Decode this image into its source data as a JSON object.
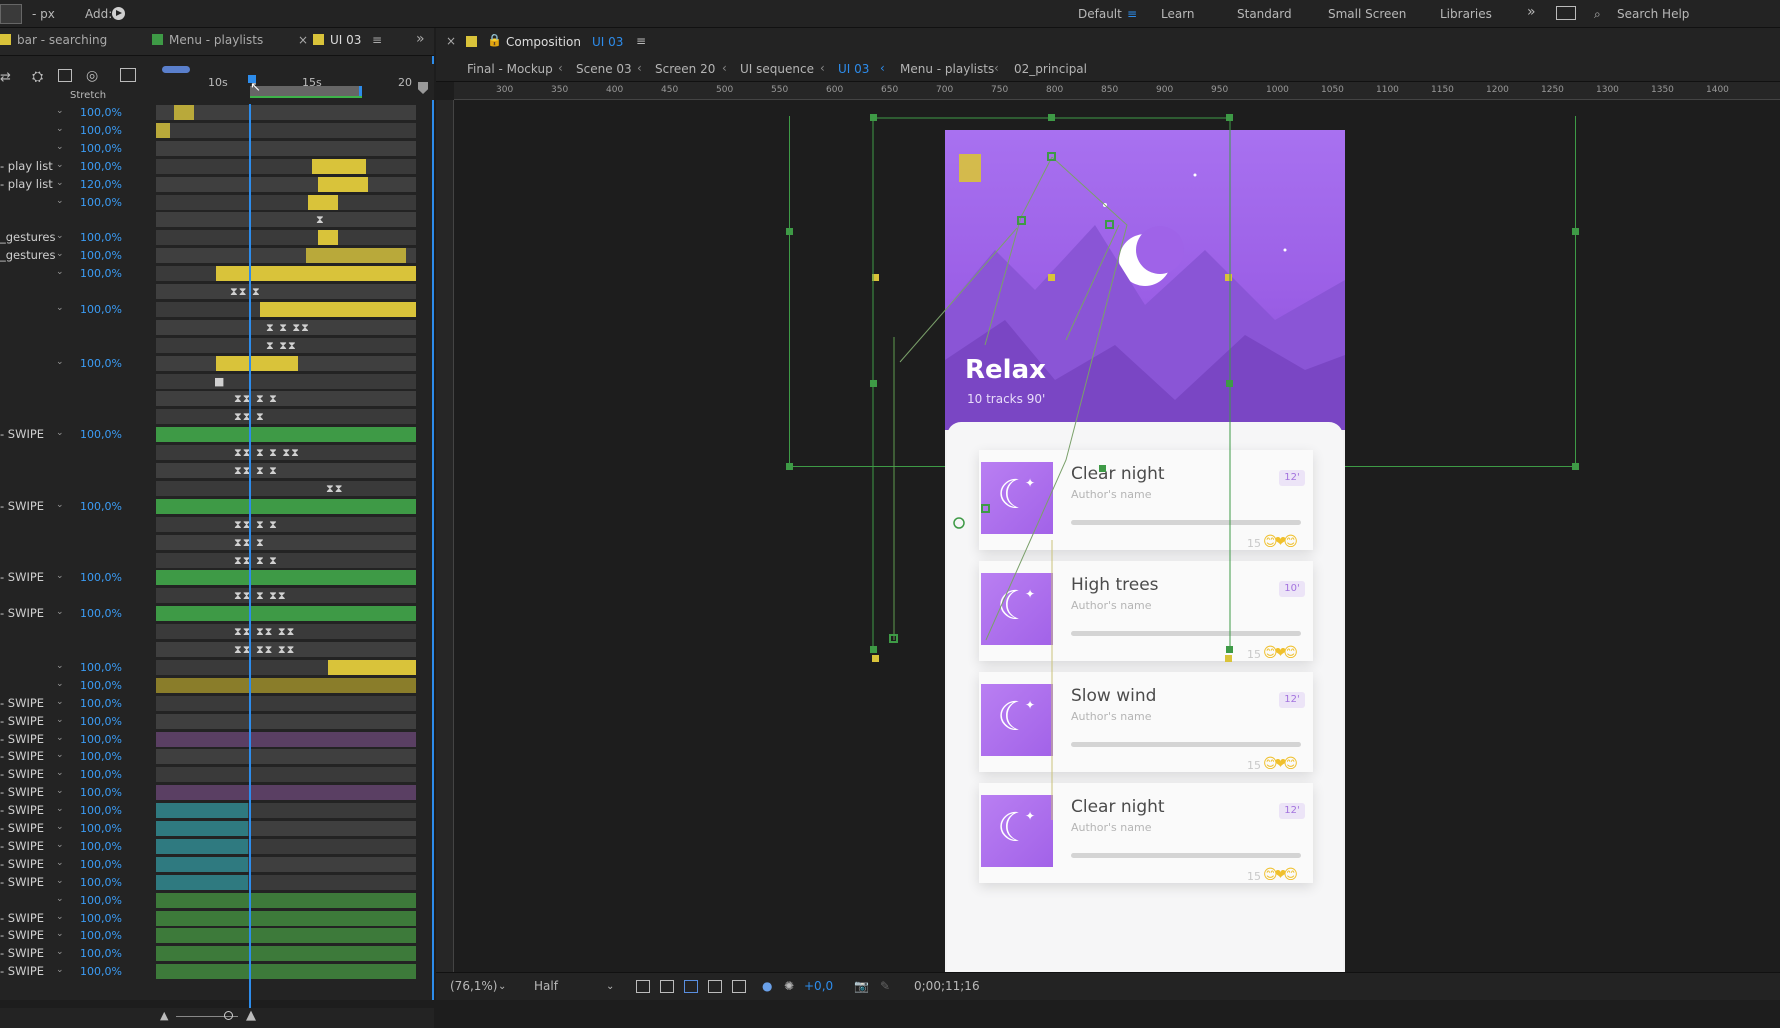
{
  "topbar": {
    "units": "- px",
    "add_label": "Add:",
    "workspaces": [
      "Default",
      "Learn",
      "Standard",
      "Small Screen",
      "Libraries"
    ],
    "active_workspace": "Default",
    "search_label": "Search Help"
  },
  "left_tabs": [
    {
      "label": "bar - searching",
      "color": "#d9c33a"
    },
    {
      "label": "Menu - playlists",
      "color": "#3e9a46"
    },
    {
      "label": "UI 03",
      "color": "#d9c33a"
    }
  ],
  "timeline": {
    "ruler_labels": [
      "10s",
      "15s",
      "20"
    ],
    "column_header": "Stretch",
    "rows": [
      {
        "name": "",
        "value": "100,0%",
        "bar": {
          "color": "#b9a93a"
        },
        "kf": ""
      },
      {
        "name": "",
        "value": "100,0%",
        "bar": {
          "color": "#b9a93a"
        },
        "kf": ""
      },
      {
        "name": "",
        "value": "100,0%",
        "bar": null,
        "kf": ""
      },
      {
        "name": "- play list",
        "value": "100,0%",
        "bar": {
          "color": "#d9c33a"
        },
        "kf": ""
      },
      {
        "name": "- play list",
        "value": "120,0%",
        "bar": {
          "color": "#d9c33a"
        },
        "kf": ""
      },
      {
        "name": "",
        "value": "100,0%",
        "bar": {
          "color": "#d9c33a"
        },
        "kf": ""
      },
      {
        "name": "",
        "value": "",
        "bar": null,
        "kf": "⧗"
      },
      {
        "name": "_gestures",
        "value": "100,0%",
        "bar": {
          "color": "#d9c33a"
        },
        "kf": ""
      },
      {
        "name": "_gestures",
        "value": "100,0%",
        "bar": {
          "color": "#b9a93a"
        },
        "kf": ""
      },
      {
        "name": "",
        "value": "100,0%",
        "bar": {
          "color": "#d9c33a"
        },
        "kf": ""
      },
      {
        "name": "",
        "value": "",
        "bar": null,
        "kf": "⧗⧗ ⧗"
      },
      {
        "name": "",
        "value": "100,0%",
        "bar": {
          "color": "#d9c33a"
        },
        "kf": ""
      },
      {
        "name": "",
        "value": "",
        "bar": null,
        "kf": "⧗ ⧗  ⧗⧗"
      },
      {
        "name": "",
        "value": "",
        "bar": null,
        "kf": "⧗    ⧗⧗"
      },
      {
        "name": "",
        "value": "100,0%",
        "bar": {
          "color": "#d9c33a"
        },
        "kf": ""
      },
      {
        "name": "",
        "value": "",
        "bar": null,
        "kf": "■"
      },
      {
        "name": "",
        "value": "",
        "bar": null,
        "kf": "⧗⧗ ⧗ ⧗"
      },
      {
        "name": "",
        "value": "",
        "bar": null,
        "kf": "⧗⧗ ⧗"
      },
      {
        "name": "- SWIPE",
        "value": "100,0%",
        "bar": {
          "color": "#3e9a46"
        },
        "kf": ""
      },
      {
        "name": "",
        "value": "",
        "bar": null,
        "kf": "⧗⧗ ⧗ ⧗  ⧗⧗"
      },
      {
        "name": "",
        "value": "",
        "bar": null,
        "kf": "⧗⧗ ⧗    ⧗"
      },
      {
        "name": "",
        "value": "",
        "bar": null,
        "kf": "⧗⧗"
      },
      {
        "name": "- SWIPE",
        "value": "100,0%",
        "bar": {
          "color": "#3e9a46"
        },
        "kf": ""
      },
      {
        "name": "",
        "value": "",
        "bar": null,
        "kf": "⧗⧗ ⧗ ⧗"
      },
      {
        "name": "",
        "value": "",
        "bar": null,
        "kf": "⧗⧗ ⧗"
      },
      {
        "name": "",
        "value": "",
        "bar": null,
        "kf": "⧗⧗ ⧗ ⧗"
      },
      {
        "name": "- SWIPE",
        "value": "100,0%",
        "bar": {
          "color": "#3e9a46"
        },
        "kf": ""
      },
      {
        "name": "",
        "value": "",
        "bar": null,
        "kf": "⧗⧗ ⧗   ⧗⧗"
      },
      {
        "name": "- SWIPE",
        "value": "100,0%",
        "bar": {
          "color": "#3e9a46"
        },
        "kf": ""
      },
      {
        "name": "",
        "value": "",
        "bar": null,
        "kf": "⧗⧗ ⧗⧗  ⧗⧗"
      },
      {
        "name": "",
        "value": "",
        "bar": null,
        "kf": "⧗⧗ ⧗⧗  ⧗⧗"
      },
      {
        "name": "",
        "value": "100,0%",
        "bar": {
          "color": "#d9c33a"
        },
        "kf": ""
      },
      {
        "name": "",
        "value": "100,0%",
        "bar": {
          "color": "#8a7d2a"
        },
        "kf": ""
      },
      {
        "name": "- SWIPE",
        "value": "100,0%",
        "bar": null,
        "kf": ""
      },
      {
        "name": "- SWIPE",
        "value": "100,0%",
        "bar": null,
        "kf": ""
      },
      {
        "name": "- SWIPE",
        "value": "100,0%",
        "bar": {
          "color": "#5a3f63"
        },
        "kf": ""
      },
      {
        "name": "- SWIPE",
        "value": "100,0%",
        "bar": null,
        "kf": ""
      },
      {
        "name": "- SWIPE",
        "value": "100,0%",
        "bar": null,
        "kf": ""
      },
      {
        "name": "- SWIPE",
        "value": "100,0%",
        "bar": {
          "color": "#5a3f63"
        },
        "kf": ""
      },
      {
        "name": "- SWIPE",
        "value": "100,0%",
        "bar": {
          "color": "#2f7a80"
        },
        "kf": ""
      },
      {
        "name": "- SWIPE",
        "value": "100,0%",
        "bar": {
          "color": "#2f7a80"
        },
        "kf": ""
      },
      {
        "name": "- SWIPE",
        "value": "100,0%",
        "bar": {
          "color": "#2f7a80"
        },
        "kf": ""
      },
      {
        "name": "- SWIPE",
        "value": "100,0%",
        "bar": {
          "color": "#2f7a80"
        },
        "kf": ""
      },
      {
        "name": "- SWIPE",
        "value": "100,0%",
        "bar": {
          "color": "#2f7a80"
        },
        "kf": ""
      },
      {
        "name": "",
        "value": "100,0%",
        "bar": {
          "color": "#3d7a3a"
        },
        "kf": ""
      },
      {
        "name": "- SWIPE",
        "value": "100,0%",
        "bar": {
          "color": "#3d7a3a"
        },
        "kf": ""
      },
      {
        "name": "- SWIPE",
        "value": "100,0%",
        "bar": {
          "color": "#3d7a3a"
        },
        "kf": ""
      },
      {
        "name": "- SWIPE",
        "value": "100,0%",
        "bar": {
          "color": "#3d7a3a"
        },
        "kf": ""
      },
      {
        "name": "- SWIPE",
        "value": "100,0%",
        "bar": {
          "color": "#3d7a3a"
        },
        "kf": ""
      }
    ]
  },
  "composition": {
    "tab_prefix": "Composition",
    "tab_name": "UI 03",
    "breadcrumbs": [
      "Final - Mockup",
      "Scene 03",
      "Screen 20",
      "UI sequence",
      "UI 03",
      "Menu - playlists",
      "02_principal"
    ],
    "active_crumb": "UI 03",
    "ruler_labels": [
      "300",
      "350",
      "400",
      "450",
      "500",
      "550",
      "600",
      "650",
      "700",
      "750",
      "800",
      "850",
      "900",
      "950",
      "1000",
      "1050",
      "1100",
      "1150",
      "1200",
      "1250",
      "1300",
      "1350",
      "1400"
    ]
  },
  "phone": {
    "hero_title": "Relax",
    "hero_sub": "10 tracks    90'",
    "cards": [
      {
        "title": "Clear night",
        "author": "Author's name",
        "duration": "12'",
        "count": "15",
        "emoji": "😊❤😊"
      },
      {
        "title": "High trees",
        "author": "Author's name",
        "duration": "10'",
        "count": "15",
        "emoji": "😊❤😊"
      },
      {
        "title": "Slow wind",
        "author": "Author's name",
        "duration": "12'",
        "count": "15",
        "emoji": "😊❤😊"
      },
      {
        "title": "Clear night",
        "author": "Author's name",
        "duration": "12'",
        "count": "15",
        "emoji": "😊❤😊"
      }
    ]
  },
  "bottombar": {
    "zoom": "(76,1%)",
    "resolution": "Half",
    "exposure": "+0,0",
    "timecode": "0;00;11;16"
  },
  "colors": {
    "accent": "#2d8ceb",
    "yellow": "#d9c33a",
    "green": "#3e9a46",
    "purple": "#a06be8"
  }
}
